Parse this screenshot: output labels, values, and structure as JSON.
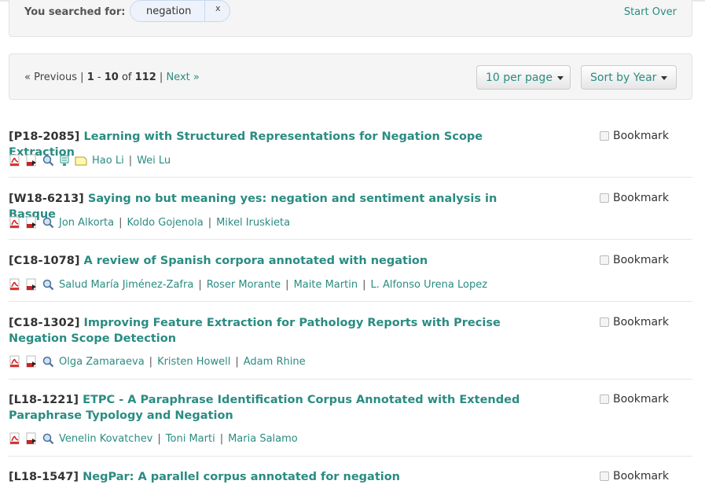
{
  "constraints": {
    "label": "You searched for:",
    "query": "negation",
    "remove_label": "x",
    "start_over": "Start Over"
  },
  "pager": {
    "previous": "« Previous",
    "sep": "|",
    "range_start": "1",
    "dash": "-",
    "range_end": "10",
    "of": "of",
    "total": "112",
    "next": "Next »"
  },
  "per_page": {
    "label": "10 per page"
  },
  "sort": {
    "label": "Sort by Year"
  },
  "results": [
    {
      "id": "[P18-2085]",
      "title": "Learning with Structured Representations for Negation Scope Extraction",
      "icons": [
        "pdf-icon",
        "bib-icon",
        "search-icon",
        "software-icon",
        "note-icon"
      ],
      "authors": [
        "Hao Li",
        "Wei Lu"
      ],
      "bookmark": "Bookmark"
    },
    {
      "id": "[W18-6213]",
      "title": "Saying no but meaning yes: negation and sentiment analysis in Basque",
      "icons": [
        "pdf-icon",
        "bib-icon",
        "search-icon"
      ],
      "authors": [
        "Jon Alkorta",
        "Koldo Gojenola",
        "Mikel Iruskieta"
      ],
      "bookmark": "Bookmark"
    },
    {
      "id": "[C18-1078]",
      "title": "A review of Spanish corpora annotated with negation",
      "icons": [
        "pdf-icon",
        "bib-icon",
        "search-icon"
      ],
      "authors": [
        "Salud María Jiménez-Zafra",
        "Roser Morante",
        "Maite Martin",
        "L. Alfonso Urena Lopez"
      ],
      "bookmark": "Bookmark"
    },
    {
      "id": "[C18-1302]",
      "title": "Improving Feature Extraction for Pathology Reports with Precise Negation Scope Detection",
      "icons": [
        "pdf-icon",
        "bib-icon",
        "search-icon"
      ],
      "authors": [
        "Olga Zamaraeva",
        "Kristen Howell",
        "Adam Rhine"
      ],
      "bookmark": "Bookmark"
    },
    {
      "id": "[L18-1221]",
      "title": "ETPC - A Paraphrase Identification Corpus Annotated with Extended Paraphrase Typology and Negation",
      "icons": [
        "pdf-icon",
        "bib-icon",
        "search-icon"
      ],
      "authors": [
        "Venelin Kovatchev",
        "Toni Marti",
        "Maria Salamo"
      ],
      "bookmark": "Bookmark"
    },
    {
      "id": "[L18-1547]",
      "title": "NegPar: A parallel corpus annotated for negation",
      "icons": [],
      "authors": [],
      "bookmark": "Bookmark"
    }
  ],
  "colors": {
    "link": "#2a8c82",
    "panel_bg": "#f5f5f5",
    "border": "#e3e3e3"
  }
}
